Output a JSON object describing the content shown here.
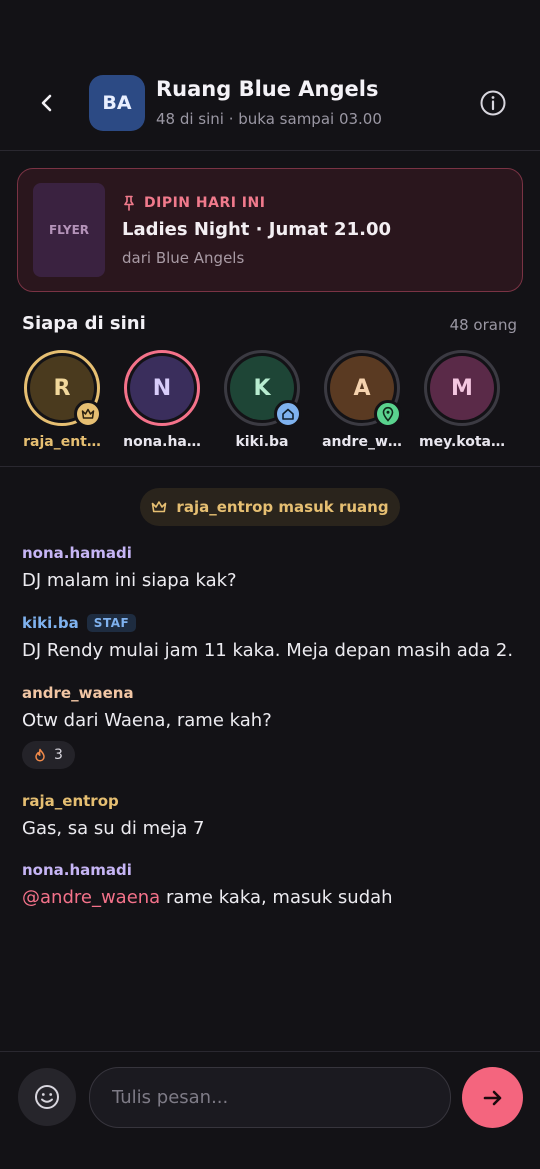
{
  "colors": {
    "background": "#131216",
    "accent": "#f4657e",
    "pin_accent": "#f07a8c"
  },
  "header": {
    "back_icon": "chevron-left-icon",
    "avatar_initials": "BA",
    "title": "Ruang Blue Angels",
    "subtitle": "48 di sini · buka sampai 03.00",
    "info_icon": "info-icon"
  },
  "pinned": {
    "flyer_label": "FLYER",
    "label": "DIPIN HARI INI",
    "title": "Ladies Night · Jumat 21.00",
    "from": "dari Blue Angels",
    "icon": "pin-icon"
  },
  "who": {
    "title": "Siapa di sini",
    "count": "48 orang",
    "members": [
      {
        "initial": "R",
        "name": "raja_ent…",
        "name_color": "#e6bf72",
        "ring": "#e6bf72",
        "bg": "#4a3a1e",
        "fg": "#f2d89c",
        "badge": "crown-icon",
        "badge_bg": "#e6bf72"
      },
      {
        "initial": "N",
        "name": "nona.ha…",
        "name_color": "#e8e6ee",
        "ring": "#f4728a",
        "bg": "#3a2e5c",
        "fg": "#d8cdfa",
        "badge": "",
        "badge_bg": ""
      },
      {
        "initial": "K",
        "name": "kiki.ba",
        "name_color": "#e8e6ee",
        "ring": "#3b3a42",
        "bg": "#1e4536",
        "fg": "#b8ecd0",
        "badge": "home-icon",
        "badge_bg": "#7fb2ef"
      },
      {
        "initial": "A",
        "name": "andre_w…",
        "name_color": "#e8e6ee",
        "ring": "#3b3a42",
        "bg": "#5a3a22",
        "fg": "#f5d2ae",
        "badge": "location-icon",
        "badge_bg": "#5ad38e"
      },
      {
        "initial": "M",
        "name": "mey.kota…",
        "name_color": "#e8e6ee",
        "ring": "#3b3a42",
        "bg": "#5a2a48",
        "fg": "#f4c6e0",
        "badge": "",
        "badge_bg": ""
      }
    ]
  },
  "chat": {
    "event": {
      "icon": "crown-icon",
      "text": "raja_entrop masuk ruang"
    },
    "messages": [
      {
        "author": "nona.hamadi",
        "color": "#c6b5f5",
        "text": "DJ malam ini siapa kak?"
      },
      {
        "author": "kiki.ba",
        "color": "#7fb2ef",
        "tag": "STAF",
        "text": "DJ Rendy mulai jam 11 kaka. Meja depan masih ada 2."
      },
      {
        "author": "andre_waena",
        "color": "#f2c6a4",
        "text": "Otw dari Waena, rame kah?",
        "reaction": {
          "icon": "fire-icon",
          "count": "3"
        }
      },
      {
        "author": "raja_entrop",
        "color": "#e6bf72",
        "text": "Gas, sa su di meja 7"
      },
      {
        "author": "nona.hamadi",
        "color": "#c6b5f5",
        "mention": "@andre_waena",
        "text": " rame kaka, masuk sudah"
      }
    ]
  },
  "composer": {
    "emoji_icon": "smiley-icon",
    "placeholder": "Tulis pesan...",
    "value": "",
    "send_icon": "arrow-right-icon"
  }
}
